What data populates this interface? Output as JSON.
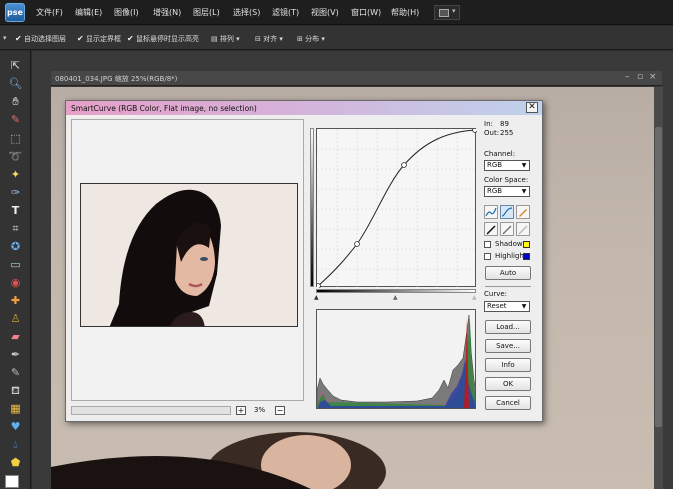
{
  "app": {
    "logo": "pse",
    "menu": [
      "文件(F)",
      "编辑(E)",
      "图像(I)",
      "增强(N)",
      "图层(L)",
      "选择(S)",
      "滤镜(T)",
      "视图(V)",
      "窗口(W)",
      "帮助(H)"
    ]
  },
  "options_bar": {
    "auto_select": "自动选择图层",
    "show_bounding": "显示定界框",
    "highlight_rollover": "鼠标悬停时显示高亮",
    "arrange": "排列",
    "align": "对齐",
    "distribute": "分布"
  },
  "toolbox": {
    "tools": [
      "move-tool",
      "zoom-tool",
      "hand-tool",
      "eyedropper-tool",
      "marquee-tool",
      "lasso-tool",
      "magic-wand-tool",
      "quick-selection-tool",
      "type-tool",
      "crop-tool",
      "cookie-cutter-tool",
      "straighten-tool",
      "red-eye-tool",
      "healing-brush-tool",
      "clone-stamp-tool",
      "eraser-tool",
      "brush-tool",
      "smart-brush-tool",
      "paint-bucket-tool",
      "gradient-tool",
      "custom-shape-tool",
      "blur-tool",
      "sponge-tool"
    ],
    "foreground_color": "#ffffff",
    "background_color": "#111111"
  },
  "document": {
    "title": "080401_034.JPG 缩放 25%(RGB/8*)"
  },
  "dialog": {
    "title": "SmartCurve (RGB Color, Flat image, no selection)",
    "close": "✕",
    "zoom_in": "+",
    "zoom_value": "3%",
    "zoom_out": "−",
    "in_label": "In:",
    "in_value": "89",
    "out_label": "Out:",
    "out_value": "255",
    "channel_label": "Channel:",
    "channel_value": "RGB",
    "colorspace_label": "Color Space:",
    "colorspace_value": "RGB",
    "shadow_label": "Shadow",
    "shadow_color": "#ffff00",
    "highlight_label": "Highlight",
    "highlight_color": "#0000cc",
    "auto": "Auto",
    "curve_label": "Curve:",
    "curve_value": "Reset",
    "buttons": {
      "load": "Load...",
      "save": "Save...",
      "info": "Info",
      "ok": "OK",
      "cancel": "Cancel"
    }
  }
}
